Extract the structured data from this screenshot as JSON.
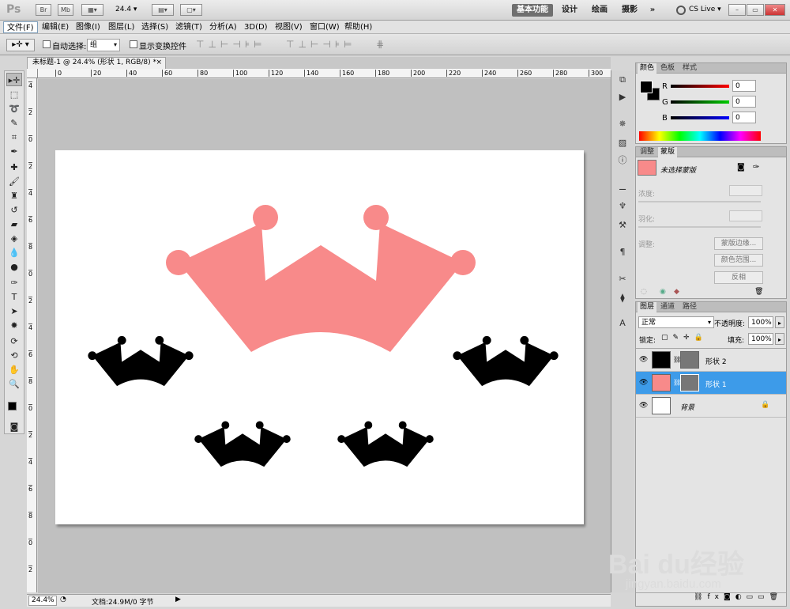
{
  "app": {
    "logo": "Ps",
    "zoom_select": "24.4",
    "workspaces": [
      "基本功能",
      "设计",
      "绘画",
      "摄影"
    ],
    "more_label": "»",
    "cslive": "CS Live",
    "header_icons": [
      "bridge-icon",
      "minibridge-icon",
      "screen-mode-icon",
      "arrange-icon"
    ]
  },
  "menus": [
    "文件(F)",
    "编辑(E)",
    "图像(I)",
    "图层(L)",
    "选择(S)",
    "滤镜(T)",
    "分析(A)",
    "3D(D)",
    "视图(V)",
    "窗口(W)",
    "帮助(H)"
  ],
  "options": {
    "auto_select_label": "自动选择:",
    "auto_select_value": "组",
    "show_transform_label": "显示变换控件"
  },
  "document": {
    "tab_title": "未标题-1 @ 24.4% (形状 1, RGB/8) *",
    "close_label": "×"
  },
  "ruler": {
    "h_ticks": [
      "0",
      "20",
      "40",
      "60",
      "80",
      "100",
      "120",
      "140",
      "160",
      "180",
      "200",
      "220",
      "240",
      "260",
      "280",
      "300"
    ],
    "v_ticks": [
      "4",
      "2",
      "0",
      "2",
      "4",
      "6",
      "8",
      "0",
      "2",
      "4",
      "6",
      "8",
      "0",
      "2",
      "4",
      "6",
      "8",
      "0",
      "2"
    ]
  },
  "status": {
    "zoom": "24.4%",
    "doc_info": "文档:24.9M/0 字节"
  },
  "colors": {
    "crown_pink": "#f88a8a",
    "crown_black": "#000000",
    "selection_blue": "#3d9be9"
  },
  "color_panel": {
    "tabs": [
      "颜色",
      "色板",
      "样式"
    ],
    "channels": [
      {
        "label": "R",
        "value": "0"
      },
      {
        "label": "G",
        "value": "0"
      },
      {
        "label": "B",
        "value": "0"
      }
    ]
  },
  "mask_panel": {
    "tabs": [
      "调整",
      "蒙版"
    ],
    "status": "未选择蒙版",
    "density_label": "浓度:",
    "feather_label": "羽化:",
    "refine_label": "调整:",
    "buttons": [
      "蒙版边缘...",
      "颜色范围...",
      "反相"
    ]
  },
  "layers_panel": {
    "tabs": [
      "图层",
      "通道",
      "路径"
    ],
    "blend_mode": "正常",
    "opacity_label": "不透明度:",
    "opacity": "100%",
    "lock_label": "锁定:",
    "fill_label": "填充:",
    "fill": "100%",
    "layers": [
      {
        "name": "形状 2",
        "selected": false
      },
      {
        "name": "形状 1",
        "selected": true
      },
      {
        "name": "背景",
        "selected": false
      }
    ]
  },
  "watermark": {
    "brand": "Bai du经验",
    "url": "jingyan.baidu.com"
  }
}
